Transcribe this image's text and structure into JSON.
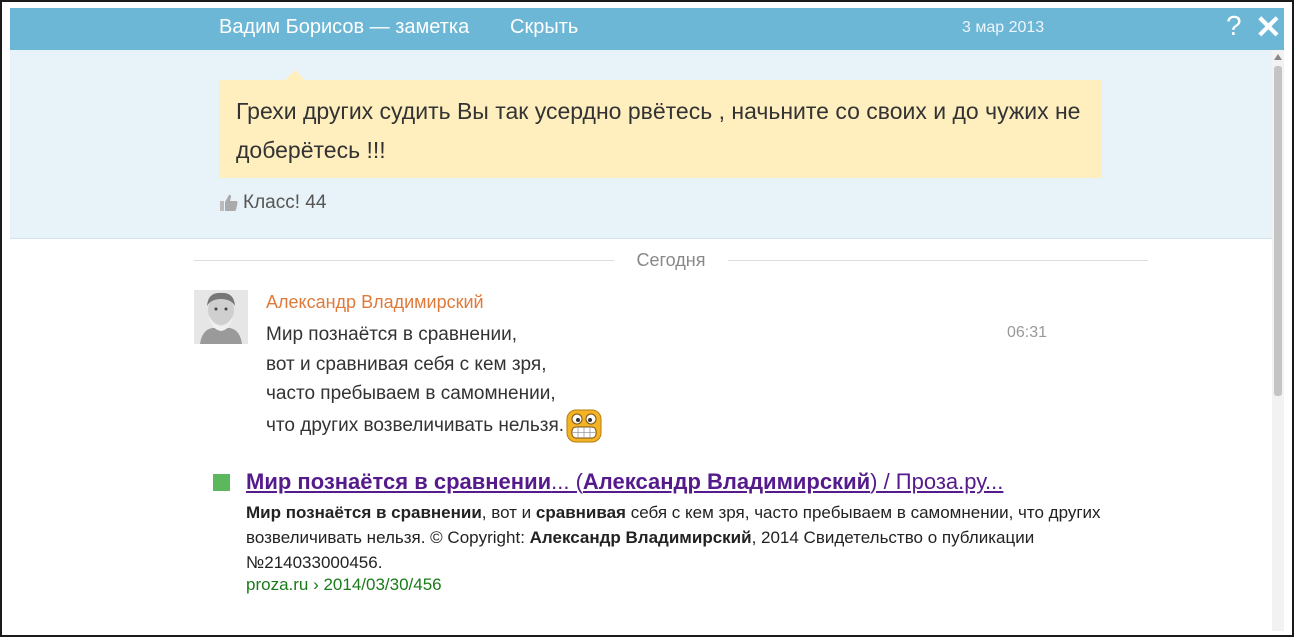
{
  "header": {
    "title": "Вадим Борисов — заметка",
    "hide_label": "Скрыть",
    "date": "3 мар 2013",
    "help_label": "?",
    "close_label": "✕"
  },
  "note": {
    "text": "Грехи других судить Вы так усердно рвётесь , начьните со своих и до чужих не доберётесь !!!",
    "klass_label": "Класс! 44"
  },
  "divider_label": "Сегодня",
  "comment": {
    "author": "Александр Владимирский",
    "time": "06:31",
    "lines": [
      "Мир познаётся в сравнении,",
      "вот и сравнивая себя с кем зря,",
      "часто пребываем в самомнении,",
      "что других возвеличивать нельзя."
    ]
  },
  "search_result": {
    "title_bold1": "Мир познаётся в сравнении",
    "title_plain1": "... (",
    "title_bold2": "Александр Владимирский",
    "title_plain2": ") / Проза.ру...",
    "snippet_b1": "Мир познаётся в сравнении",
    "snippet_t1": ", вот и ",
    "snippet_b2": "сравнивая",
    "snippet_t2": " себя с кем зря, часто пребываем в самомнении, что других возвеличивать нельзя. © Copyright: ",
    "snippet_b3": "Александр Владимирский",
    "snippet_t3": ", 2014 Свидетельство о публикации №214033000456.",
    "url": "proza.ru › 2014/03/30/456"
  }
}
